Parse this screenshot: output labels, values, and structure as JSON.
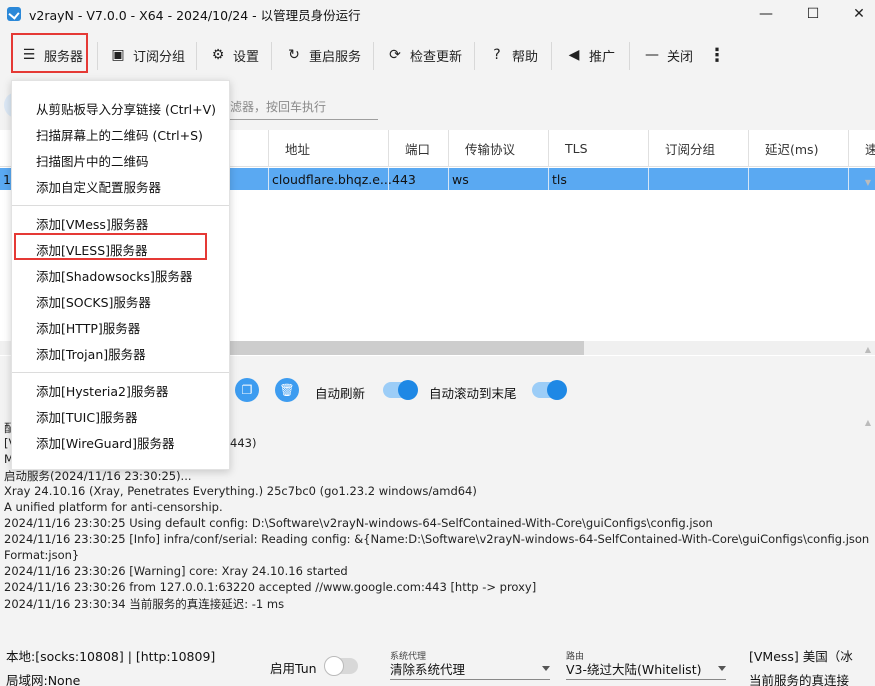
{
  "window": {
    "title": "v2rayN - V7.0.0 - X64 - 2024/10/24 - 以管理员身份运行",
    "minimize": "—",
    "maximize": "☐",
    "close": "✕"
  },
  "toolbar": {
    "servers": "服务器",
    "subscription_group": "订阅分组",
    "settings": "设置",
    "restart_service": "重启服务",
    "check_update": "检查更新",
    "help": "帮助",
    "promotion": "推广",
    "close": "关闭",
    "more": "⋮"
  },
  "filter": {
    "placeholder": "滤器，按回车执行"
  },
  "grid": {
    "headers": [
      "地址",
      "端口",
      "传输协议",
      "TLS",
      "订阅分组",
      "延迟(ms)",
      "速"
    ],
    "row": {
      "index": "1",
      "address": "cloudflare.bhqz.e...",
      "port": "443",
      "transport": "ws",
      "tls": "tls"
    }
  },
  "menu": {
    "items": [
      "从剪贴板导入分享链接 (Ctrl+V)",
      "扫描屏幕上的二维码 (Ctrl+S)",
      "扫描图片中的二维码",
      "添加自定义配置服务器",
      "添加[VMess]服务器",
      "添加[VLESS]服务器",
      "添加[Shadowsocks]服务器",
      "添加[SOCKS]服务器",
      "添加[HTTP]服务器",
      "添加[Trojan]服务器",
      "添加[Hysteria2]服务器",
      "添加[TUIC]服务器",
      "添加[WireGuard]服务器"
    ]
  },
  "log_controls": {
    "auto_refresh": "自动刷新",
    "auto_scroll": "自动滚动到末尾"
  },
  "log": {
    "partial_lines": [
      "配",
      "[V",
      "M"
    ],
    "partial_tail": "443)",
    "lines": [
      "启动服务(2024/11/16 23:30:25)...",
      "Xray 24.10.16 (Xray, Penetrates Everything.) 25c7bc0 (go1.23.2 windows/amd64)",
      "A unified platform for anti-censorship.",
      "2024/11/16 23:30:25 Using default config:  D:\\Software\\v2rayN-windows-64-SelfContained-With-Core\\guiConfigs\\config.json",
      "2024/11/16 23:30:25 [Info] infra/conf/serial: Reading config: &{Name:D:\\Software\\v2rayN-windows-64-SelfContained-With-Core\\guiConfigs\\config.json",
      "Format:json}",
      "2024/11/16 23:30:26 [Warning] core: Xray 24.10.16 started",
      "2024/11/16 23:30:26 from 127.0.0.1:63220 accepted //www.google.com:443 [http -> proxy]",
      "2024/11/16 23:30:34 当前服务的真连接延迟: -1 ms"
    ]
  },
  "status": {
    "local": "本地:[socks:10808] | [http:10809]",
    "lan": "局域网:None",
    "tun_label": "启用Tun",
    "system_proxy_label": "系统代理",
    "system_proxy_value": "清除系统代理",
    "routing_label": "路由",
    "routing_value": "V3-绕过大陆(Whitelist)",
    "server_info": "[VMess] 美国（冰",
    "server_delay": "当前服务的真连接"
  }
}
